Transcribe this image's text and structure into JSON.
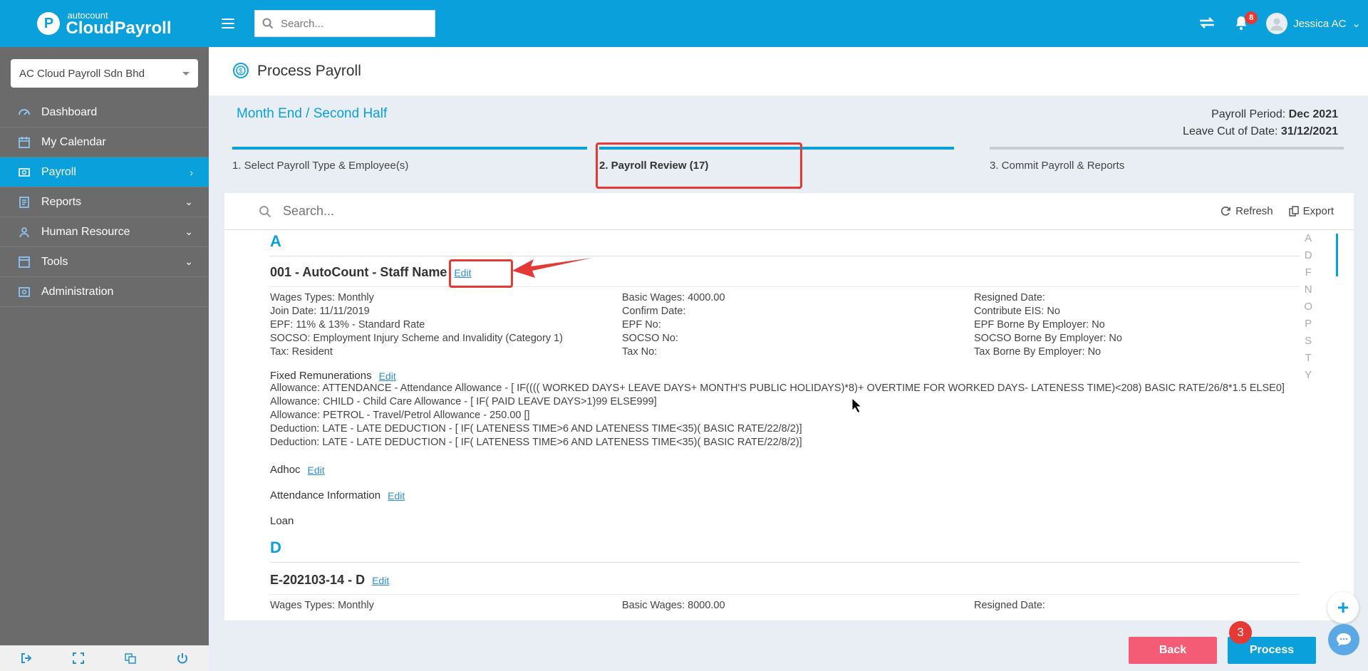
{
  "brand": {
    "small": "autocount",
    "big": "CloudPayroll",
    "logo_letter": "P"
  },
  "company": {
    "selected": "AC Cloud Payroll Sdn Bhd"
  },
  "sidebar": {
    "items": [
      {
        "label": "Dashboard",
        "icon": "dashboard-icon",
        "active": false,
        "arrow": ""
      },
      {
        "label": "My Calendar",
        "icon": "calendar-icon",
        "active": false,
        "arrow": ""
      },
      {
        "label": "Payroll",
        "icon": "payroll-icon",
        "active": true,
        "arrow": "›"
      },
      {
        "label": "Reports",
        "icon": "reports-icon",
        "active": false,
        "arrow": "⌄"
      },
      {
        "label": "Human Resource",
        "icon": "human-resource-icon",
        "active": false,
        "arrow": "⌄"
      },
      {
        "label": "Tools",
        "icon": "tools-icon",
        "active": false,
        "arrow": "⌄"
      },
      {
        "label": "Administration",
        "icon": "administration-icon",
        "active": false,
        "arrow": ""
      }
    ]
  },
  "topbar": {
    "search_placeholder": "Search...",
    "notification_count": "8",
    "user_name": "Jessica AC"
  },
  "page": {
    "title": "Process Payroll"
  },
  "payroll": {
    "type_title": "Month End / Second Half",
    "period_label": "Payroll Period:",
    "period_value": "Dec 2021",
    "cutoff_label": "Leave Cut of Date:",
    "cutoff_value": "31/12/2021"
  },
  "steps": [
    {
      "label": "1. Select Payroll Type & Employee(s)"
    },
    {
      "label": "2. Payroll Review (17)"
    },
    {
      "label": "3. Commit Payroll & Reports"
    }
  ],
  "review": {
    "search_placeholder": "Search...",
    "refresh_label": "Refresh",
    "export_label": "Export",
    "alpha_index": [
      "A",
      "D",
      "F",
      "N",
      "O",
      "P",
      "S",
      "T",
      "Y"
    ],
    "sections": [
      {
        "letter": "A",
        "employee": {
          "name": "001 - AutoCount - Staff Name",
          "edit_label": "Edit",
          "col1": [
            "Wages Types: Monthly",
            "Join Date: 11/11/2019",
            "EPF: 11% & 13% - Standard Rate",
            "SOCSO: Employment Injury Scheme and Invalidity (Category 1)",
            "Tax: Resident"
          ],
          "col2": [
            "Basic Wages: 4000.00",
            "Confirm Date:",
            "EPF No:",
            "SOCSO No:",
            "Tax No:"
          ],
          "col3": [
            "Resigned Date:",
            "Contribute EIS: No",
            "EPF Borne By Employer: No",
            "SOCSO Borne By Employer: No",
            "Tax Borne By Employer: No"
          ],
          "fixed_label": "Fixed Remunerations",
          "fixed_edit": "Edit",
          "fixed_lines": [
            "Allowance: ATTENDANCE - Attendance Allowance - [ IF(((( WORKED DAYS+ LEAVE DAYS+ MONTH'S PUBLIC HOLIDAYS)*8)+ OVERTIME FOR WORKED DAYS- LATENESS TIME)<208) BASIC RATE/26/8*1.5 ELSE0]",
            "Allowance: CHILD - Child Care Allowance - [ IF( PAID LEAVE DAYS>1)99 ELSE999]",
            "Allowance: PETROL - Travel/Petrol Allowance - 250.00 []",
            "Deduction: LATE - LATE DEDUCTION - [ IF( LATENESS TIME>6 AND LATENESS TIME<35)( BASIC RATE/22/8/2)]",
            "Deduction: LATE - LATE DEDUCTION - [ IF( LATENESS TIME>6 AND LATENESS TIME<35)( BASIC RATE/22/8/2)]"
          ],
          "adhoc_label": "Adhoc",
          "adhoc_edit": "Edit",
          "attendance_label": "Attendance Information",
          "attendance_edit": "Edit",
          "loan_label": "Loan"
        }
      },
      {
        "letter": "D",
        "employee": {
          "name": "E-202103-14 - D",
          "edit_label": "Edit",
          "col1": [
            "Wages Types: Monthly"
          ],
          "col2": [
            "Basic Wages: 8000.00"
          ],
          "col3": [
            "Resigned Date:"
          ]
        }
      }
    ]
  },
  "actions": {
    "back_label": "Back",
    "process_label": "Process",
    "step_badge": "3"
  },
  "colors": {
    "accent": "#09a0dc",
    "sidebar": "#6b6b6b",
    "danger": "#e53935",
    "back": "#f45c75"
  }
}
